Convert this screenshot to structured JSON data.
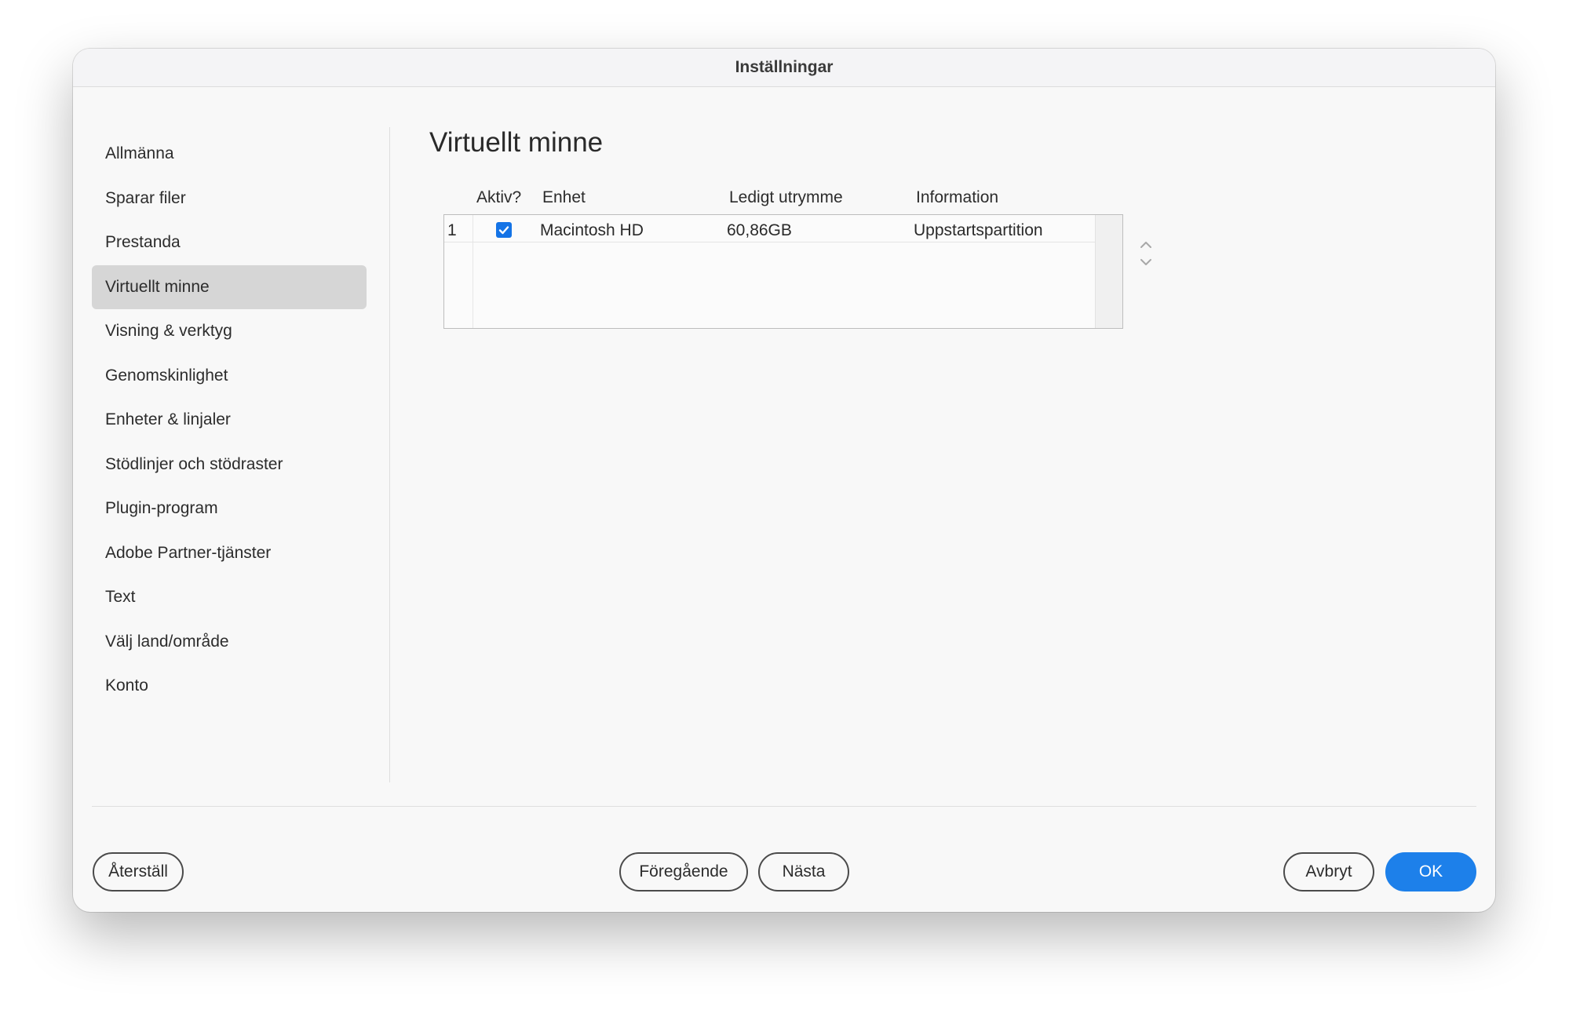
{
  "window": {
    "title": "Inställningar"
  },
  "sidebar": {
    "items": [
      {
        "label": "Allmänna"
      },
      {
        "label": "Sparar filer"
      },
      {
        "label": "Prestanda"
      },
      {
        "label": "Virtuellt minne",
        "selected": true
      },
      {
        "label": "Visning & verktyg"
      },
      {
        "label": "Genomskinlighet"
      },
      {
        "label": "Enheter & linjaler"
      },
      {
        "label": "Stödlinjer och stödraster"
      },
      {
        "label": "Plugin-program"
      },
      {
        "label": "Adobe Partner-tjänster"
      },
      {
        "label": "Text"
      },
      {
        "label": "Välj land/område"
      },
      {
        "label": "Konto"
      }
    ]
  },
  "content": {
    "title": "Virtuellt minne",
    "table": {
      "headers": {
        "active": "Aktiv?",
        "device": "Enhet",
        "free_space": "Ledigt utrymme",
        "info": "Information"
      },
      "rows": [
        {
          "index": "1",
          "active": true,
          "device": "Macintosh HD",
          "free_space": "60,86GB",
          "info": "Uppstartspartition"
        }
      ]
    }
  },
  "footer": {
    "reset_label": "Återställ",
    "prev_label": "Föregående",
    "next_label": "Nästa",
    "cancel_label": "Avbryt",
    "ok_label": "OK"
  },
  "colors": {
    "accent": "#1d80ea",
    "checkbox": "#1473e6",
    "selected_row": "#d6d6d6"
  }
}
